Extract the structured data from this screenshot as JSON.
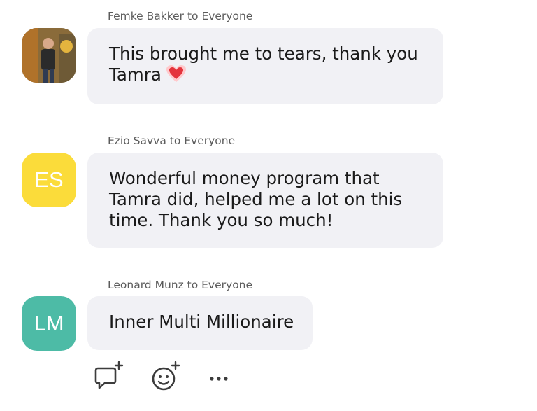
{
  "messages": [
    {
      "sender": "Femke Bakker to Everyone",
      "avatar_type": "photo",
      "lines": [
        "This brought me to tears, thank you",
        "Tamra"
      ],
      "reaction_icon": "heart-icon"
    },
    {
      "sender": "Ezio Savva to Everyone",
      "avatar_type": "initials",
      "initials": "ES",
      "avatar_color": "#fbdc3a",
      "lines": [
        "Wonderful money program that",
        "Tamra did, helped me a lot on this",
        "time. Thank you so much!"
      ]
    },
    {
      "sender": "Leonard Munz to Everyone",
      "avatar_type": "initials",
      "initials": "LM",
      "avatar_color": "#4dbba6",
      "lines": [
        "Inner Multi Millionaire"
      ]
    }
  ],
  "actions": {
    "reply_icon": "add-comment-icon",
    "react_icon": "add-reaction-icon",
    "more_icon": "more-icon",
    "more_label": "•••"
  },
  "colors": {
    "bubble_bg": "#f1f1f5",
    "icon_color": "#3c3c3c",
    "heart": "#e4343d"
  }
}
